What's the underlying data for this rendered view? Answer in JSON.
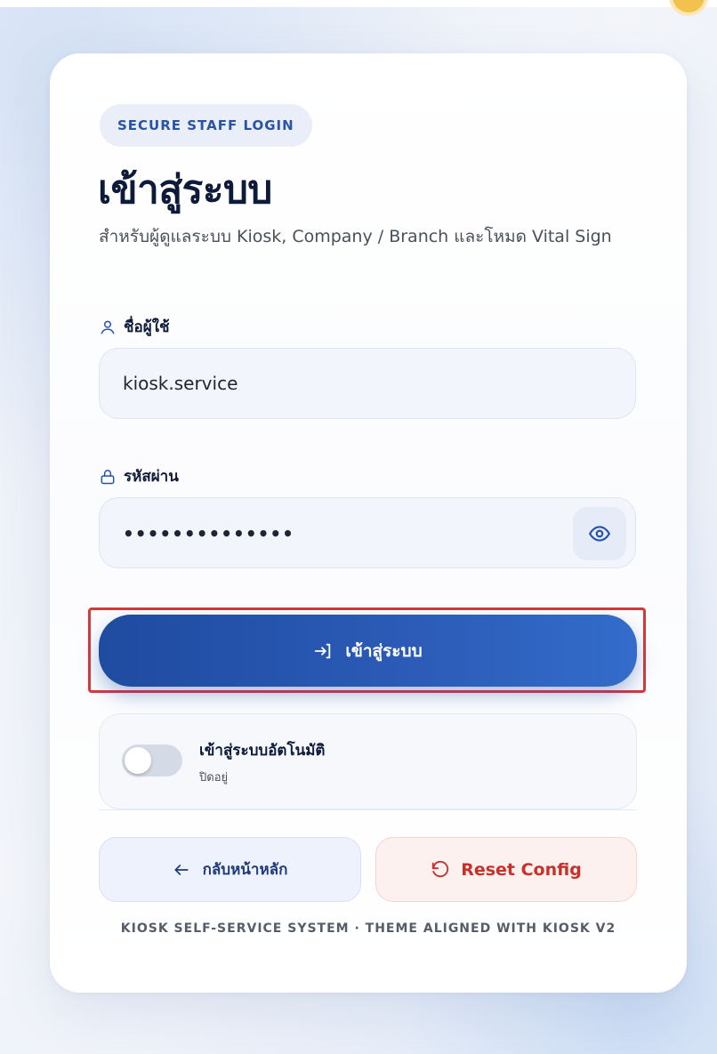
{
  "header": {
    "badge": "SECURE STAFF LOGIN",
    "title": "เข้าสู่ระบบ",
    "subtitle": "สำหรับผู้ดูแลระบบ Kiosk, Company / Branch และโหมด Vital Sign"
  },
  "form": {
    "username_label": "ชื่อผู้ใช้",
    "username_value": "kiosk.service",
    "password_label": "รหัสผ่าน",
    "password_masked": "••••••••••••••",
    "toggle_visibility_icon": "eye-icon",
    "login_button_label": "เข้าสู่ระบบ",
    "login_button_icon": "login-arrow-icon"
  },
  "auto_login": {
    "title": "เข้าสู่ระบบอัตโนมัติ",
    "status": "ปิดอยู่",
    "enabled": false
  },
  "actions": {
    "back_label": "กลับหน้าหลัก",
    "back_icon": "arrow-left-icon",
    "reset_label": "Reset Config",
    "reset_icon": "reset-icon"
  },
  "footer": {
    "text": "KIOSK SELF-SERVICE SYSTEM · THEME ALIGNED WITH KIOSK V2"
  },
  "colors": {
    "primary": "#2c5cb8",
    "danger": "#c8302b",
    "highlight_outline": "#d33a3a"
  }
}
